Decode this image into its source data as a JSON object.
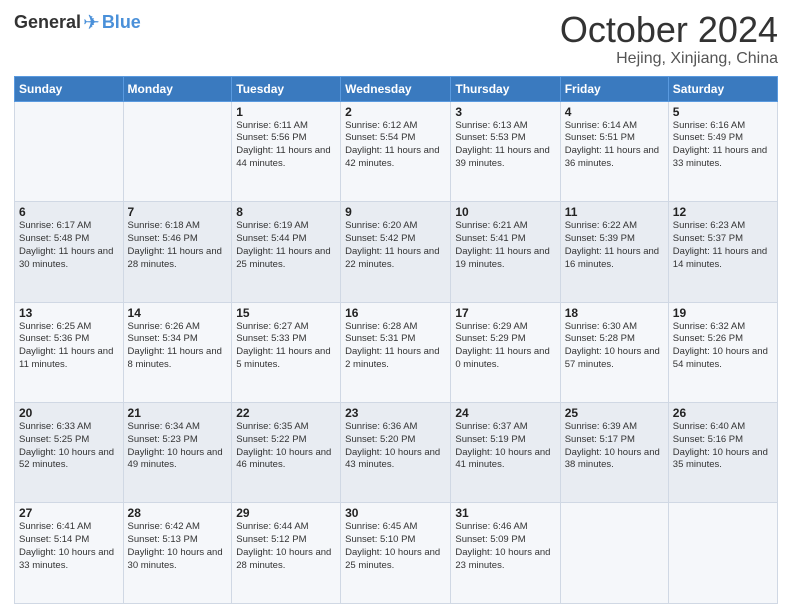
{
  "header": {
    "logo_general": "General",
    "logo_blue": "Blue",
    "month_title": "October 2024",
    "location": "Hejing, Xinjiang, China"
  },
  "weekdays": [
    "Sunday",
    "Monday",
    "Tuesday",
    "Wednesday",
    "Thursday",
    "Friday",
    "Saturday"
  ],
  "weeks": [
    [
      {
        "day": "",
        "sunrise": "",
        "sunset": "",
        "daylight": ""
      },
      {
        "day": "",
        "sunrise": "",
        "sunset": "",
        "daylight": ""
      },
      {
        "day": "1",
        "sunrise": "Sunrise: 6:11 AM",
        "sunset": "Sunset: 5:56 PM",
        "daylight": "Daylight: 11 hours and 44 minutes."
      },
      {
        "day": "2",
        "sunrise": "Sunrise: 6:12 AM",
        "sunset": "Sunset: 5:54 PM",
        "daylight": "Daylight: 11 hours and 42 minutes."
      },
      {
        "day": "3",
        "sunrise": "Sunrise: 6:13 AM",
        "sunset": "Sunset: 5:53 PM",
        "daylight": "Daylight: 11 hours and 39 minutes."
      },
      {
        "day": "4",
        "sunrise": "Sunrise: 6:14 AM",
        "sunset": "Sunset: 5:51 PM",
        "daylight": "Daylight: 11 hours and 36 minutes."
      },
      {
        "day": "5",
        "sunrise": "Sunrise: 6:16 AM",
        "sunset": "Sunset: 5:49 PM",
        "daylight": "Daylight: 11 hours and 33 minutes."
      }
    ],
    [
      {
        "day": "6",
        "sunrise": "Sunrise: 6:17 AM",
        "sunset": "Sunset: 5:48 PM",
        "daylight": "Daylight: 11 hours and 30 minutes."
      },
      {
        "day": "7",
        "sunrise": "Sunrise: 6:18 AM",
        "sunset": "Sunset: 5:46 PM",
        "daylight": "Daylight: 11 hours and 28 minutes."
      },
      {
        "day": "8",
        "sunrise": "Sunrise: 6:19 AM",
        "sunset": "Sunset: 5:44 PM",
        "daylight": "Daylight: 11 hours and 25 minutes."
      },
      {
        "day": "9",
        "sunrise": "Sunrise: 6:20 AM",
        "sunset": "Sunset: 5:42 PM",
        "daylight": "Daylight: 11 hours and 22 minutes."
      },
      {
        "day": "10",
        "sunrise": "Sunrise: 6:21 AM",
        "sunset": "Sunset: 5:41 PM",
        "daylight": "Daylight: 11 hours and 19 minutes."
      },
      {
        "day": "11",
        "sunrise": "Sunrise: 6:22 AM",
        "sunset": "Sunset: 5:39 PM",
        "daylight": "Daylight: 11 hours and 16 minutes."
      },
      {
        "day": "12",
        "sunrise": "Sunrise: 6:23 AM",
        "sunset": "Sunset: 5:37 PM",
        "daylight": "Daylight: 11 hours and 14 minutes."
      }
    ],
    [
      {
        "day": "13",
        "sunrise": "Sunrise: 6:25 AM",
        "sunset": "Sunset: 5:36 PM",
        "daylight": "Daylight: 11 hours and 11 minutes."
      },
      {
        "day": "14",
        "sunrise": "Sunrise: 6:26 AM",
        "sunset": "Sunset: 5:34 PM",
        "daylight": "Daylight: 11 hours and 8 minutes."
      },
      {
        "day": "15",
        "sunrise": "Sunrise: 6:27 AM",
        "sunset": "Sunset: 5:33 PM",
        "daylight": "Daylight: 11 hours and 5 minutes."
      },
      {
        "day": "16",
        "sunrise": "Sunrise: 6:28 AM",
        "sunset": "Sunset: 5:31 PM",
        "daylight": "Daylight: 11 hours and 2 minutes."
      },
      {
        "day": "17",
        "sunrise": "Sunrise: 6:29 AM",
        "sunset": "Sunset: 5:29 PM",
        "daylight": "Daylight: 11 hours and 0 minutes."
      },
      {
        "day": "18",
        "sunrise": "Sunrise: 6:30 AM",
        "sunset": "Sunset: 5:28 PM",
        "daylight": "Daylight: 10 hours and 57 minutes."
      },
      {
        "day": "19",
        "sunrise": "Sunrise: 6:32 AM",
        "sunset": "Sunset: 5:26 PM",
        "daylight": "Daylight: 10 hours and 54 minutes."
      }
    ],
    [
      {
        "day": "20",
        "sunrise": "Sunrise: 6:33 AM",
        "sunset": "Sunset: 5:25 PM",
        "daylight": "Daylight: 10 hours and 52 minutes."
      },
      {
        "day": "21",
        "sunrise": "Sunrise: 6:34 AM",
        "sunset": "Sunset: 5:23 PM",
        "daylight": "Daylight: 10 hours and 49 minutes."
      },
      {
        "day": "22",
        "sunrise": "Sunrise: 6:35 AM",
        "sunset": "Sunset: 5:22 PM",
        "daylight": "Daylight: 10 hours and 46 minutes."
      },
      {
        "day": "23",
        "sunrise": "Sunrise: 6:36 AM",
        "sunset": "Sunset: 5:20 PM",
        "daylight": "Daylight: 10 hours and 43 minutes."
      },
      {
        "day": "24",
        "sunrise": "Sunrise: 6:37 AM",
        "sunset": "Sunset: 5:19 PM",
        "daylight": "Daylight: 10 hours and 41 minutes."
      },
      {
        "day": "25",
        "sunrise": "Sunrise: 6:39 AM",
        "sunset": "Sunset: 5:17 PM",
        "daylight": "Daylight: 10 hours and 38 minutes."
      },
      {
        "day": "26",
        "sunrise": "Sunrise: 6:40 AM",
        "sunset": "Sunset: 5:16 PM",
        "daylight": "Daylight: 10 hours and 35 minutes."
      }
    ],
    [
      {
        "day": "27",
        "sunrise": "Sunrise: 6:41 AM",
        "sunset": "Sunset: 5:14 PM",
        "daylight": "Daylight: 10 hours and 33 minutes."
      },
      {
        "day": "28",
        "sunrise": "Sunrise: 6:42 AM",
        "sunset": "Sunset: 5:13 PM",
        "daylight": "Daylight: 10 hours and 30 minutes."
      },
      {
        "day": "29",
        "sunrise": "Sunrise: 6:44 AM",
        "sunset": "Sunset: 5:12 PM",
        "daylight": "Daylight: 10 hours and 28 minutes."
      },
      {
        "day": "30",
        "sunrise": "Sunrise: 6:45 AM",
        "sunset": "Sunset: 5:10 PM",
        "daylight": "Daylight: 10 hours and 25 minutes."
      },
      {
        "day": "31",
        "sunrise": "Sunrise: 6:46 AM",
        "sunset": "Sunset: 5:09 PM",
        "daylight": "Daylight: 10 hours and 23 minutes."
      },
      {
        "day": "",
        "sunrise": "",
        "sunset": "",
        "daylight": ""
      },
      {
        "day": "",
        "sunrise": "",
        "sunset": "",
        "daylight": ""
      }
    ]
  ]
}
